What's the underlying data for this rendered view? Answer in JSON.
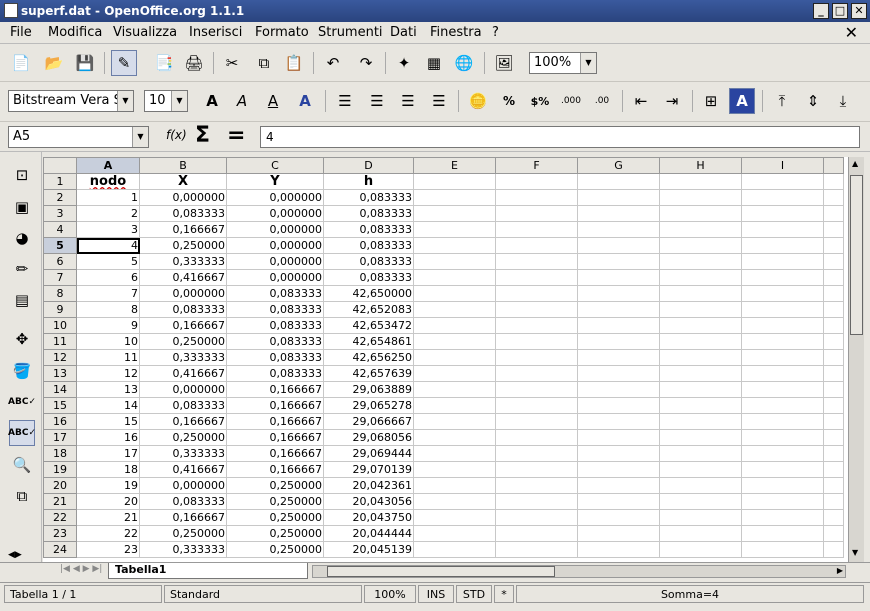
{
  "window": {
    "title": "superf.dat - OpenOffice.org 1.1.1"
  },
  "menu": {
    "file": "File",
    "edit": "Modifica",
    "view": "Visualizza",
    "insert": "Inserisci",
    "format": "Formato",
    "tools": "Strumenti",
    "data": "Dati",
    "window": "Finestra",
    "help": "?",
    "close": "✕"
  },
  "toolbar": {
    "zoom": "100%"
  },
  "format": {
    "font": "Bitstream Vera Sa",
    "size": "10",
    "bold": "A",
    "italic": "A",
    "underline": "A",
    "fontcolor": "A",
    "currency": "$%",
    "percent": "%"
  },
  "formula": {
    "cellref": "A5",
    "fx": "f(x)",
    "sigma": "Σ",
    "equal": "=",
    "content": "4"
  },
  "columns": [
    "A",
    "B",
    "C",
    "D",
    "E",
    "F",
    "G",
    "H",
    "I"
  ],
  "header_row": {
    "row": "1",
    "a": "nodo",
    "b": "X",
    "c": "Y",
    "d": "h"
  },
  "rows": [
    {
      "row": "2",
      "a": "1",
      "b": "0,000000",
      "c": "0,000000",
      "d": "0,083333"
    },
    {
      "row": "3",
      "a": "2",
      "b": "0,083333",
      "c": "0,000000",
      "d": "0,083333"
    },
    {
      "row": "4",
      "a": "3",
      "b": "0,166667",
      "c": "0,000000",
      "d": "0,083333"
    },
    {
      "row": "5",
      "a": "4",
      "b": "0,250000",
      "c": "0,000000",
      "d": "0,083333"
    },
    {
      "row": "6",
      "a": "5",
      "b": "0,333333",
      "c": "0,000000",
      "d": "0,083333"
    },
    {
      "row": "7",
      "a": "6",
      "b": "0,416667",
      "c": "0,000000",
      "d": "0,083333"
    },
    {
      "row": "8",
      "a": "7",
      "b": "0,000000",
      "c": "0,083333",
      "d": "42,650000"
    },
    {
      "row": "9",
      "a": "8",
      "b": "0,083333",
      "c": "0,083333",
      "d": "42,652083"
    },
    {
      "row": "10",
      "a": "9",
      "b": "0,166667",
      "c": "0,083333",
      "d": "42,653472"
    },
    {
      "row": "11",
      "a": "10",
      "b": "0,250000",
      "c": "0,083333",
      "d": "42,654861"
    },
    {
      "row": "12",
      "a": "11",
      "b": "0,333333",
      "c": "0,083333",
      "d": "42,656250"
    },
    {
      "row": "13",
      "a": "12",
      "b": "0,416667",
      "c": "0,083333",
      "d": "42,657639"
    },
    {
      "row": "14",
      "a": "13",
      "b": "0,000000",
      "c": "0,166667",
      "d": "29,063889"
    },
    {
      "row": "15",
      "a": "14",
      "b": "0,083333",
      "c": "0,166667",
      "d": "29,065278"
    },
    {
      "row": "16",
      "a": "15",
      "b": "0,166667",
      "c": "0,166667",
      "d": "29,066667"
    },
    {
      "row": "17",
      "a": "16",
      "b": "0,250000",
      "c": "0,166667",
      "d": "29,068056"
    },
    {
      "row": "18",
      "a": "17",
      "b": "0,333333",
      "c": "0,166667",
      "d": "29,069444"
    },
    {
      "row": "19",
      "a": "18",
      "b": "0,416667",
      "c": "0,166667",
      "d": "29,070139"
    },
    {
      "row": "20",
      "a": "19",
      "b": "0,000000",
      "c": "0,250000",
      "d": "20,042361"
    },
    {
      "row": "21",
      "a": "20",
      "b": "0,083333",
      "c": "0,250000",
      "d": "20,043056"
    },
    {
      "row": "22",
      "a": "21",
      "b": "0,166667",
      "c": "0,250000",
      "d": "20,043750"
    },
    {
      "row": "23",
      "a": "22",
      "b": "0,250000",
      "c": "0,250000",
      "d": "20,044444"
    },
    {
      "row": "24",
      "a": "23",
      "b": "0,333333",
      "c": "0,250000",
      "d": "20,045139"
    }
  ],
  "sheet_tab": "Tabella1",
  "status": {
    "sheet": "Tabella 1 / 1",
    "style": "Standard",
    "zoom": "100%",
    "ins": "INS",
    "std": "STD",
    "star": "*",
    "sum": "Somma=4"
  }
}
